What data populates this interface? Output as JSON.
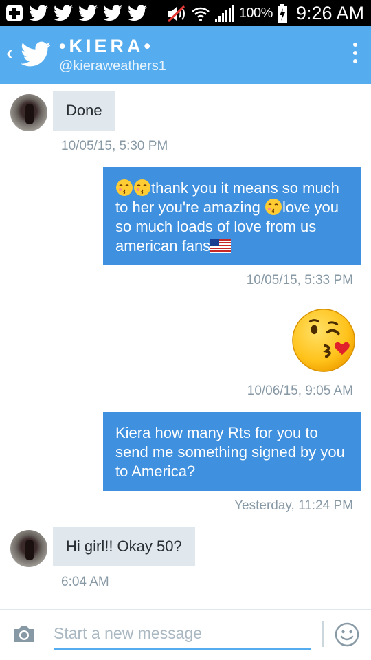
{
  "status_bar": {
    "battery_percent": "100%",
    "time": "9:26 AM",
    "icons": [
      "plus-icon",
      "twitter-bird-icon",
      "twitter-bird-icon",
      "twitter-bird-icon",
      "twitter-bird-icon",
      "twitter-bird-icon",
      "muted-speaker-icon",
      "wifi-icon",
      "signal-icon",
      "battery-charging-icon"
    ]
  },
  "header": {
    "back_glyph": "‹",
    "title": "•KIERA•",
    "handle": "@kieraweathers1",
    "icons": [
      "back-icon",
      "twitter-logo-icon",
      "overflow-menu-icon"
    ]
  },
  "messages": [
    {
      "direction": "incoming",
      "text": "Done",
      "time": "10/05/15, 5:30 PM"
    },
    {
      "direction": "outgoing",
      "parts": [
        "thank you it means so much to her you're amazing ",
        "love you so much loads of love from us american fans"
      ],
      "emojis": [
        "kissing-face-with-closed-eyes",
        "kissing-face-with-closed-eyes",
        "kissing-face-with-closed-eyes",
        "us-flag"
      ],
      "time": "10/05/15, 5:33 PM"
    },
    {
      "direction": "outgoing",
      "emoji": "face-throwing-a-kiss",
      "time": "10/06/15, 9:05 AM"
    },
    {
      "direction": "outgoing",
      "text": "Kiera how many Rts for you to send me something signed by you to America?",
      "time": "Yesterday, 11:24 PM"
    },
    {
      "direction": "incoming",
      "text": "Hi girl!! Okay 50?",
      "time": "6:04 AM"
    }
  ],
  "composer": {
    "placeholder": "Start a new message",
    "icons": [
      "camera-icon",
      "emoji-smiley-icon"
    ]
  },
  "colors": {
    "accent": "#55acee",
    "outgoing_bubble": "#3f90de",
    "incoming_bubble": "#e1e8ed",
    "timestamp": "#8899a6"
  }
}
